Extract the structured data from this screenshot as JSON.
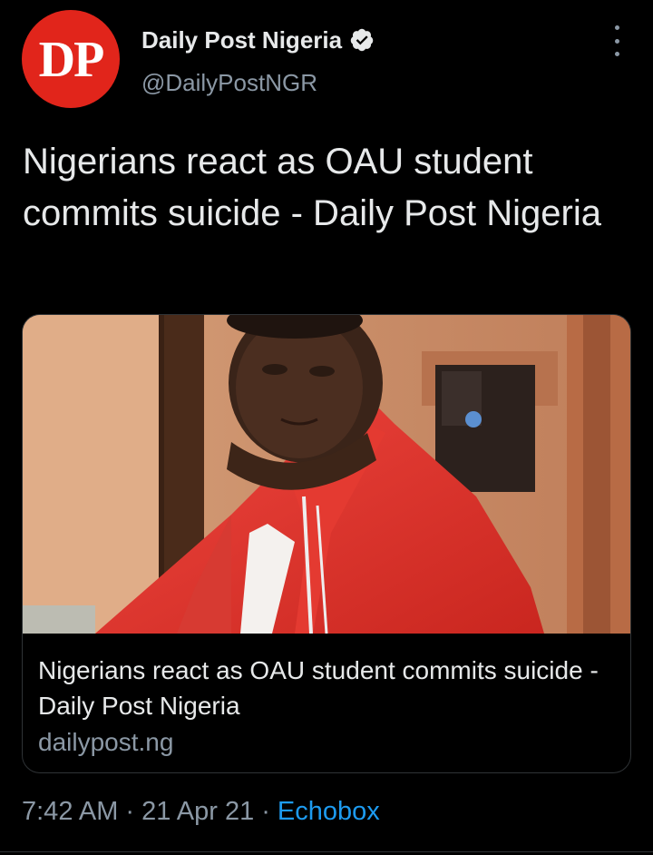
{
  "account": {
    "avatar_text": "DP",
    "display_name": "Daily Post Nigeria",
    "verified_icon": "verified-badge-icon",
    "handle": "@DailyPostNGR"
  },
  "menu": {
    "icon": "more-vertical-icon"
  },
  "tweet": {
    "text": "Nigerians react as OAU student commits suicide - Daily Post Nigeria"
  },
  "card": {
    "image_icon": "article-photo",
    "title": "Nigerians react as OAU student commits suicide - Daily Post Nigeria",
    "domain": "dailypost.ng"
  },
  "meta": {
    "time": "7:42 AM",
    "separator": "·",
    "date": "21 Apr 21",
    "source": "Echobox"
  },
  "colors": {
    "background": "#000000",
    "avatar": "#e1251b",
    "text": "#e7e9ea",
    "secondary": "#8b98a5",
    "link": "#1d9bf0"
  }
}
